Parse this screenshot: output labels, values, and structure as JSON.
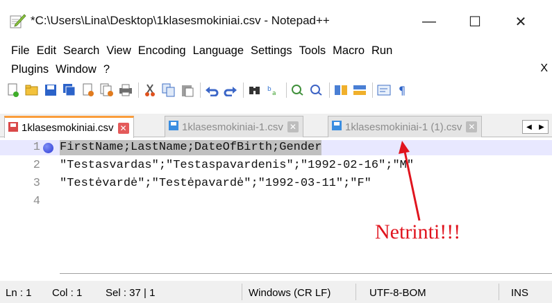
{
  "window": {
    "title": "*C:\\Users\\Lina\\Desktop\\1klasesmokiniai.csv - Notepad++",
    "minimize": "—",
    "maximize": "☐",
    "close": "✕"
  },
  "menu": {
    "row1": [
      "File",
      "Edit",
      "Search",
      "View",
      "Encoding",
      "Language",
      "Settings",
      "Tools",
      "Macro",
      "Run"
    ],
    "row2": [
      "Plugins",
      "Window",
      "?"
    ],
    "close_doc": "X"
  },
  "toolbar": {
    "icons": [
      "new-file-icon",
      "open-file-icon",
      "save-icon",
      "save-all-icon",
      "close-icon",
      "close-all-icon",
      "print-icon",
      "cut-icon",
      "copy-icon",
      "paste-icon",
      "undo-icon",
      "redo-icon",
      "find-icon",
      "replace-icon",
      "zoom-in-icon",
      "zoom-out-icon",
      "sync-vertical-icon",
      "sync-horizontal-icon",
      "word-wrap-icon",
      "show-all-chars-icon"
    ]
  },
  "tabs": [
    {
      "label": "1klasesmokiniai.csv",
      "active": true
    },
    {
      "label": "1klasesmokiniai-1.csv",
      "active": false
    },
    {
      "label": "1klasesmokiniai-1 (1).csv",
      "active": false
    }
  ],
  "editor": {
    "lines": [
      {
        "num": "1",
        "text": "FirstName;LastName;DateOfBirth;Gender"
      },
      {
        "num": "2",
        "text": "\"Testasvardas\";\"Testaspavardenis\";\"1992-02-16\";\"M\""
      },
      {
        "num": "3",
        "text": "\"Testėvardė\";\"Testėpavardė\";\"1992-03-11\";\"F\""
      },
      {
        "num": "4",
        "text": ""
      }
    ]
  },
  "annotation": {
    "text": "Netrinti!!!",
    "color": "#e0141e"
  },
  "status": {
    "ln": "Ln : 1",
    "col": "Col : 1",
    "sel": "Sel : 37 | 1",
    "eol": "Windows (CR LF)",
    "encoding": "UTF-8-BOM",
    "mode": "INS"
  }
}
